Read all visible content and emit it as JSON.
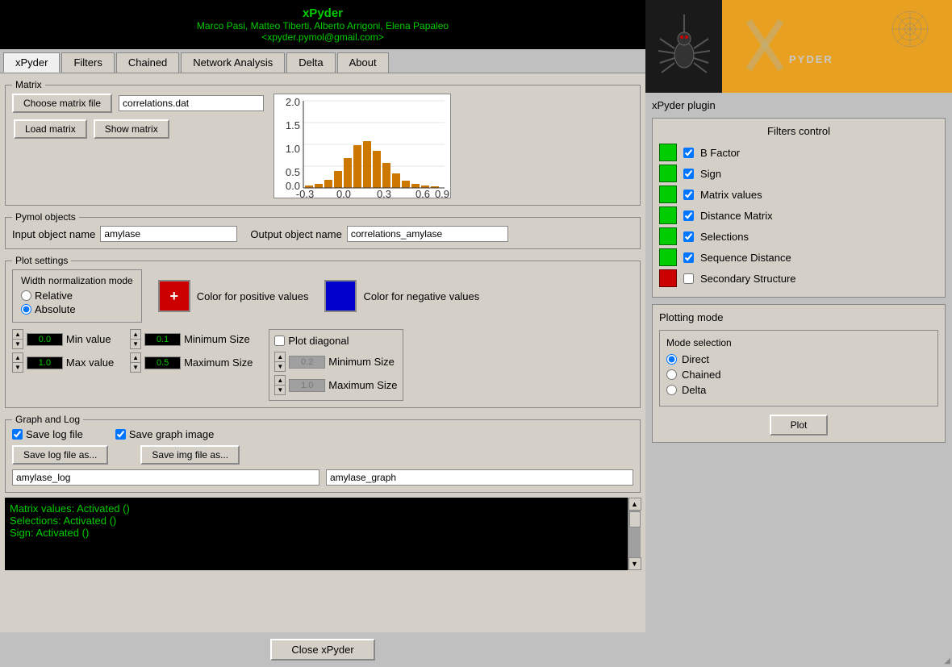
{
  "header": {
    "app_name": "xPyder",
    "authors": "Marco Pasi, Matteo Tiberti, Alberto Arrigoni, Elena Papaleo",
    "email": "<xpyder.pymol@gmail.com>"
  },
  "tabs": {
    "items": [
      {
        "label": "xPyder",
        "active": true
      },
      {
        "label": "Filters",
        "active": false
      },
      {
        "label": "Chained",
        "active": false
      },
      {
        "label": "Network Analysis",
        "active": false
      },
      {
        "label": "Delta",
        "active": false
      },
      {
        "label": "About",
        "active": false
      }
    ]
  },
  "matrix": {
    "group_label": "Matrix",
    "choose_btn": "Choose matrix file",
    "file_value": "correlations.dat",
    "load_btn": "Load matrix",
    "show_btn": "Show matrix"
  },
  "pymol_objects": {
    "group_label": "Pymol objects",
    "input_label": "Input object name",
    "input_value": "amylase",
    "output_label": "Output object name",
    "output_value": "correlations_amylase"
  },
  "plot_settings": {
    "group_label": "Plot settings",
    "width_norm_title": "Width normalization mode",
    "relative_label": "Relative",
    "absolute_label": "Absolute",
    "absolute_checked": true,
    "positive_label": "Color for positive values",
    "negative_label": "Color for negative values",
    "positive_color": "#cc0000",
    "negative_color": "#0000cc",
    "positive_symbol": "+",
    "min_value_label": "Min value",
    "max_value_label": "Max value",
    "min_value": "0.0",
    "max_value": "1.0",
    "min_size_label1": "Minimum Size",
    "max_size_label1": "Maximum Size",
    "min_size_value1": "0.1",
    "max_size_value1": "0.5",
    "plot_diagonal_label": "Plot diagonal",
    "min_size_label2": "Minimum Size",
    "max_size_label2": "Maximum Size",
    "min_size_value2": "0.2",
    "max_size_value2": "1.0"
  },
  "graph_log": {
    "group_label": "Graph and Log",
    "save_log_label": "Save log file",
    "save_graph_label": "Save graph image",
    "save_log_btn": "Save log file as...",
    "save_img_btn": "Save img file as...",
    "log_filename": "amylase_log",
    "graph_filename": "amylase_graph"
  },
  "console": {
    "lines": [
      "Matrix values: Activated ()",
      "Selections: Activated ()",
      "Sign: Activated ()"
    ]
  },
  "footer": {
    "close_btn": "Close xPyder"
  },
  "right_panel": {
    "plugin_title": "xPyder plugin",
    "logo_text": "XPYDER",
    "filters_control": {
      "title": "Filters control",
      "items": [
        {
          "label": "B Factor",
          "checked": true,
          "color": "green"
        },
        {
          "label": "Sign",
          "checked": true,
          "color": "green"
        },
        {
          "label": "Matrix values",
          "checked": true,
          "color": "green"
        },
        {
          "label": "Distance Matrix",
          "checked": true,
          "color": "green"
        },
        {
          "label": "Selections",
          "checked": true,
          "color": "green"
        },
        {
          "label": "Sequence Distance",
          "checked": true,
          "color": "green"
        },
        {
          "label": "Secondary Structure",
          "checked": false,
          "color": "red"
        }
      ]
    },
    "plotting_mode": {
      "title": "Plotting mode",
      "mode_title": "Mode selection",
      "modes": [
        {
          "label": "Direct",
          "checked": true
        },
        {
          "label": "Chained",
          "checked": false
        },
        {
          "label": "Delta",
          "checked": false
        }
      ],
      "plot_btn": "Plot"
    }
  },
  "histogram": {
    "x_labels": [
      "-0.3",
      "0.0",
      "0.3",
      "0.6",
      "0.9"
    ],
    "y_labels": [
      "2.0",
      "1.5",
      "1.0",
      "0.5",
      "0.0"
    ],
    "bars": [
      {
        "height": 5,
        "rel": 0.02
      },
      {
        "height": 8,
        "rel": 0.03
      },
      {
        "height": 18,
        "rel": 0.07
      },
      {
        "height": 35,
        "rel": 0.13
      },
      {
        "height": 60,
        "rel": 0.23
      },
      {
        "height": 88,
        "rel": 0.33
      },
      {
        "height": 95,
        "rel": 0.36
      },
      {
        "height": 75,
        "rel": 0.28
      },
      {
        "height": 50,
        "rel": 0.19
      },
      {
        "height": 30,
        "rel": 0.11
      },
      {
        "height": 18,
        "rel": 0.07
      },
      {
        "height": 10,
        "rel": 0.04
      },
      {
        "height": 5,
        "rel": 0.02
      },
      {
        "height": 3,
        "rel": 0.01
      }
    ]
  }
}
